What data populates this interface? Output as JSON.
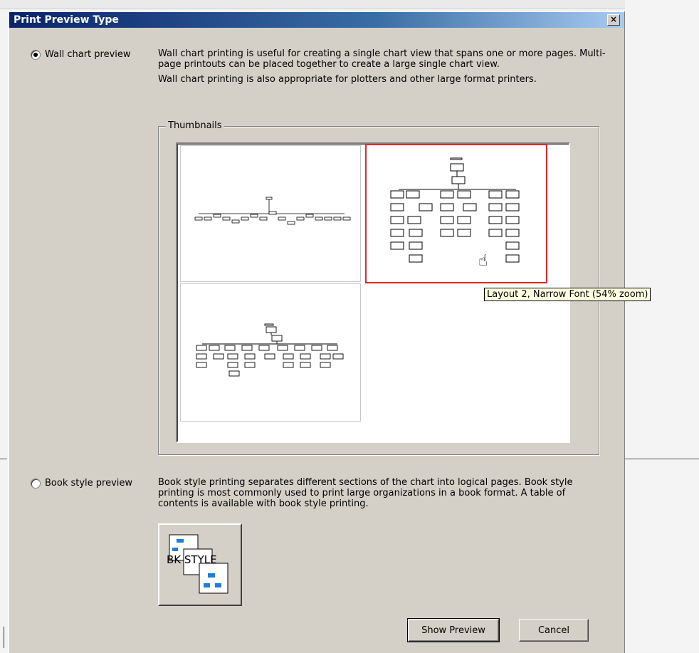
{
  "dialog": {
    "title": "Print Preview Type",
    "close_label": "×"
  },
  "wall": {
    "radio_label": "Wall chart preview",
    "selected": true,
    "desc1": "Wall chart printing is useful for creating a single chart view that spans one or more pages.  Multi-page printouts can be placed together to create a large single chart view.",
    "desc2": "Wall chart printing is also appropriate for plotters and other large format printers."
  },
  "thumbnails": {
    "group_label": "Thumbnails",
    "items": [
      {
        "name": "layout-1"
      },
      {
        "name": "layout-2",
        "selected": true
      },
      {
        "name": "layout-3"
      }
    ]
  },
  "tooltip": {
    "text": "Layout 2, Narrow Font (54% zoom)"
  },
  "book": {
    "radio_label": "Book style preview",
    "selected": false,
    "desc": "Book style printing separates different sections of the chart into logical pages. Book style printing is most commonly used to print large organizations in a book format.  A table of contents is available with book style printing.",
    "icon_text": "BK STYLE"
  },
  "buttons": {
    "show_preview": "Show Preview",
    "cancel": "Cancel"
  },
  "colors": {
    "selection_border": "#e0262b",
    "titlebar_start": "#0a246a",
    "tooltip_bg": "#ffffe1",
    "icon_blue": "#1c7fd6"
  }
}
